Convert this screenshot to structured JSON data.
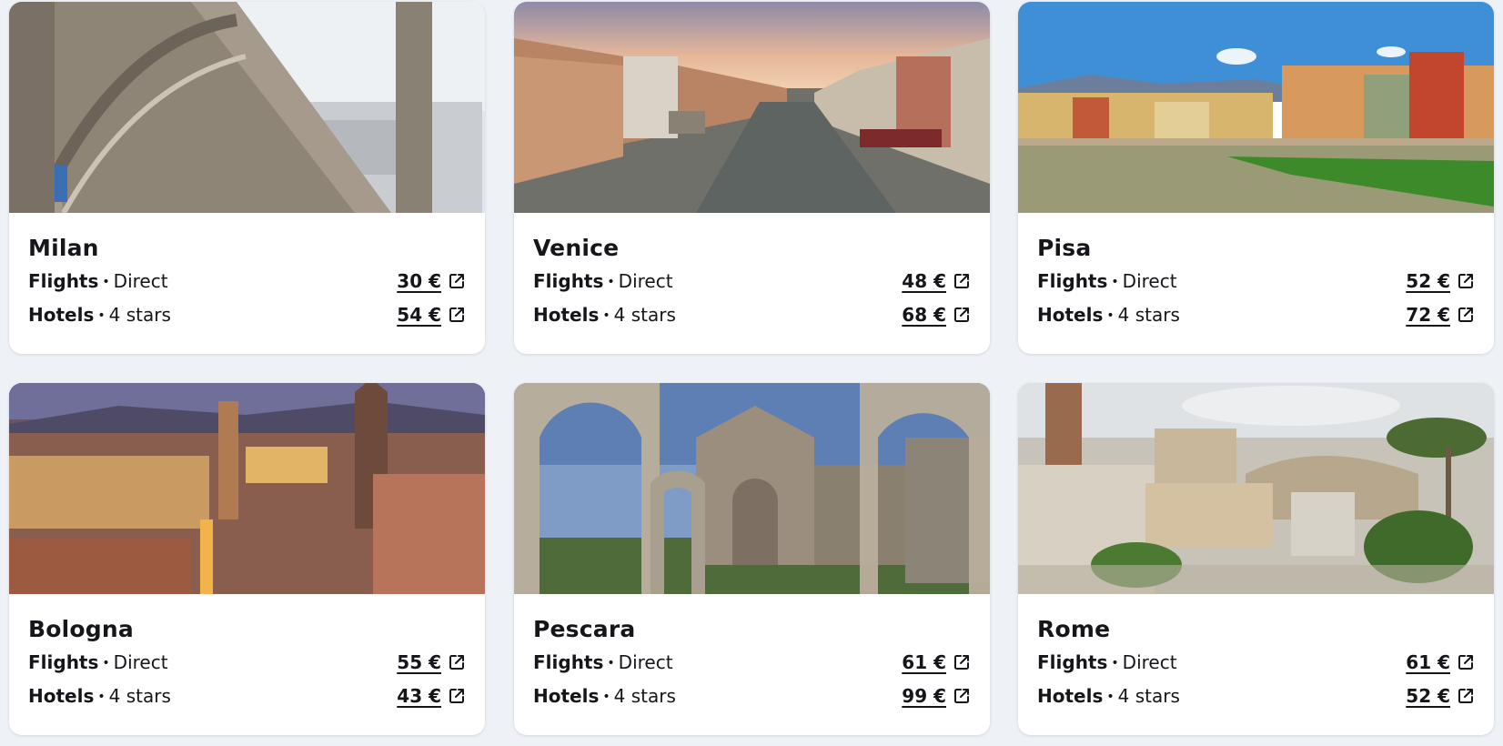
{
  "cards": [
    {
      "city": "Milan",
      "flights_label": "Flights",
      "flights_detail": "Direct",
      "flights_price": "30 €",
      "hotels_label": "Hotels",
      "hotels_detail": "4 stars",
      "hotels_price": "54 €"
    },
    {
      "city": "Venice",
      "flights_label": "Flights",
      "flights_detail": "Direct",
      "flights_price": "48 €",
      "hotels_label": "Hotels",
      "hotels_detail": "4 stars",
      "hotels_price": "68 €"
    },
    {
      "city": "Pisa",
      "flights_label": "Flights",
      "flights_detail": "Direct",
      "flights_price": "52 €",
      "hotels_label": "Hotels",
      "hotels_detail": "4 stars",
      "hotels_price": "72 €"
    },
    {
      "city": "Bologna",
      "flights_label": "Flights",
      "flights_detail": "Direct",
      "flights_price": "55 €",
      "hotels_label": "Hotels",
      "hotels_detail": "4 stars",
      "hotels_price": "43 €"
    },
    {
      "city": "Pescara",
      "flights_label": "Flights",
      "flights_detail": "Direct",
      "flights_price": "61 €",
      "hotels_label": "Hotels",
      "hotels_detail": "4 stars",
      "hotels_price": "99 €"
    },
    {
      "city": "Rome",
      "flights_label": "Flights",
      "flights_detail": "Direct",
      "flights_price": "61 €",
      "hotels_label": "Hotels",
      "hotels_detail": "4 stars",
      "hotels_price": "52 €"
    }
  ],
  "icons": {
    "external_link": "external-link-icon"
  },
  "colors": {
    "page_background": "#eef1f6",
    "card_background": "#ffffff",
    "text": "#15161a"
  }
}
